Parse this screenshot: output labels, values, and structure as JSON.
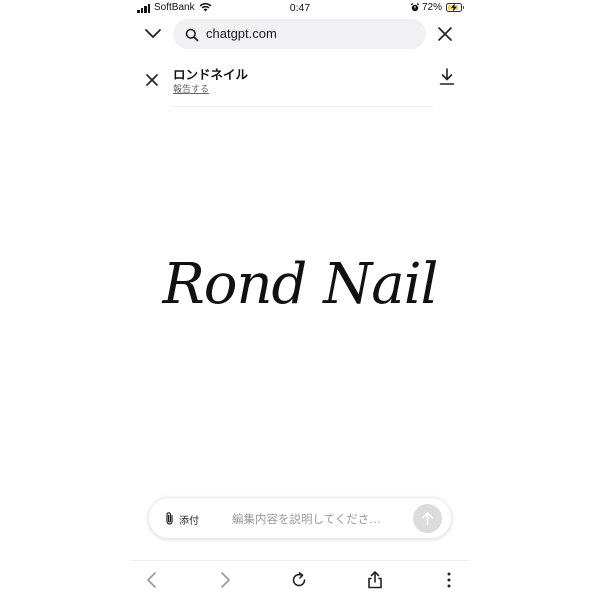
{
  "status_bar": {
    "carrier": "SoftBank",
    "time": "0:47",
    "battery_percent": "72%",
    "icons": [
      "signal-icon",
      "wifi-icon",
      "alarm-icon",
      "battery-charging-icon"
    ]
  },
  "url_bar": {
    "url": "chatgpt.com",
    "icons": [
      "chevron-down-icon",
      "search-icon",
      "close-icon"
    ]
  },
  "download_banner": {
    "title": "ロンドネイル",
    "report_link": "報告する",
    "icons": [
      "close-icon",
      "download-icon"
    ]
  },
  "logo": {
    "text": "Rond Nail"
  },
  "composer": {
    "attach_label": "添付",
    "placeholder": "編集内容を説明してくださ…",
    "icons": [
      "paperclip-icon",
      "arrow-up-icon"
    ]
  },
  "toolbar": {
    "icons": [
      "back-icon",
      "forward-icon",
      "reload-icon",
      "share-icon",
      "more-icon"
    ]
  },
  "colors": {
    "url_pill_bg": "#f1f1f3",
    "send_button_bg": "#dcdcdc",
    "battery_fill": "#f5d33b"
  }
}
